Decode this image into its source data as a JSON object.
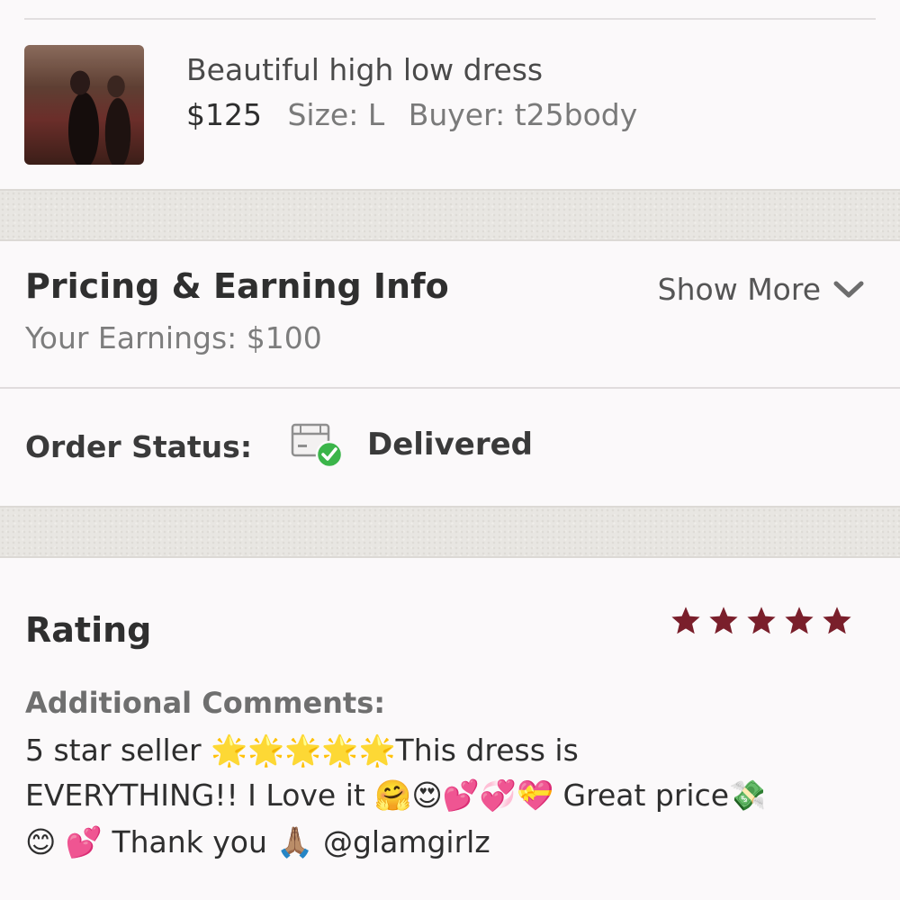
{
  "item": {
    "title": "Beautiful high low dress",
    "price": "$125",
    "size": "Size: L",
    "buyer": "Buyer: t25body"
  },
  "pricing": {
    "title": "Pricing & Earning Info",
    "earnings": "Your Earnings: $100",
    "show_more": "Show More"
  },
  "order_status": {
    "label": "Order Status:",
    "value": "Delivered",
    "icon": "package-delivered-icon"
  },
  "rating": {
    "title": "Rating",
    "stars": 5,
    "max_stars": 5,
    "star_color": "#7a1f2b"
  },
  "comments": {
    "label": "Additional Comments:",
    "line1": "5 star seller 🌟🌟🌟🌟🌟This dress is",
    "line2": "EVERYTHING!! I Love it 🤗😍💕💞💝 Great price💸",
    "line3": "😊 💕 Thank you 🙏🏽 @glamgirlz"
  },
  "colors": {
    "background": "#fbf9fa",
    "status_check": "#3bb54a"
  }
}
